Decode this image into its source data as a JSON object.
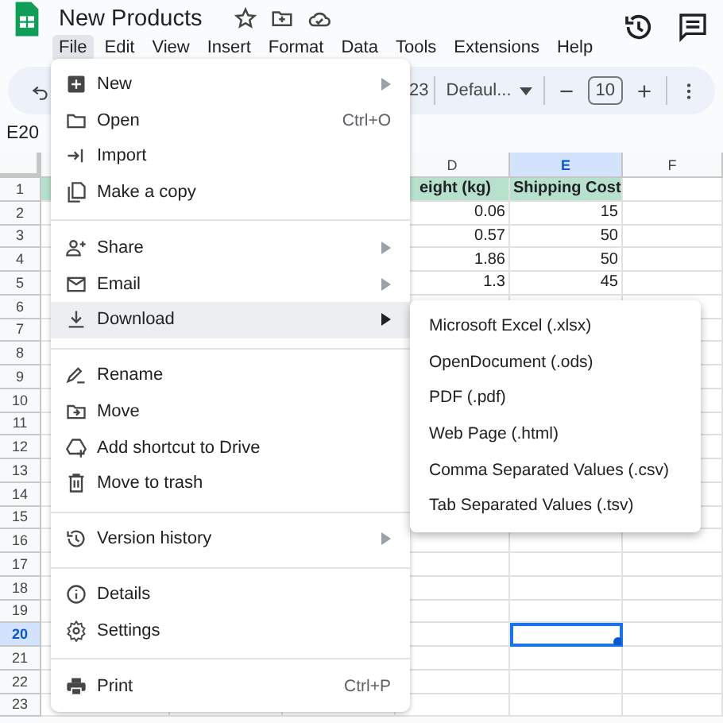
{
  "document": {
    "title": "New Products"
  },
  "menu_bar": [
    {
      "label": "File",
      "selected": true
    },
    {
      "label": "Edit",
      "selected": false
    },
    {
      "label": "View",
      "selected": false
    },
    {
      "label": "Insert",
      "selected": false
    },
    {
      "label": "Format",
      "selected": false
    },
    {
      "label": "Data",
      "selected": false
    },
    {
      "label": "Tools",
      "selected": false
    },
    {
      "label": "Extensions",
      "selected": false
    },
    {
      "label": "Help",
      "selected": false
    }
  ],
  "toolbar": {
    "number_format": "23",
    "font": "Defaul...",
    "font_size": "10"
  },
  "name_box": "E20",
  "sheet": {
    "columns": [
      {
        "label": "D",
        "selected": false
      },
      {
        "label": "E",
        "selected": true
      },
      {
        "label": "F",
        "selected": false
      }
    ],
    "rows": [
      {
        "number": "1",
        "selected": false,
        "kind": "header",
        "cells": {
          "D": "eight (kg)",
          "E": "Shipping Cost"
        }
      },
      {
        "number": "2",
        "selected": false,
        "cells": {
          "D": "0.06",
          "E": "15"
        }
      },
      {
        "number": "3",
        "selected": false,
        "cells": {
          "D": "0.57",
          "E": "50"
        }
      },
      {
        "number": "4",
        "selected": false,
        "cells": {
          "D": "1.86",
          "E": "50"
        }
      },
      {
        "number": "5",
        "selected": false,
        "cells": {
          "D": "1.3",
          "E": "45"
        }
      },
      {
        "number": "6",
        "selected": false
      },
      {
        "number": "7",
        "selected": false
      },
      {
        "number": "8",
        "selected": false
      },
      {
        "number": "9",
        "selected": false
      },
      {
        "number": "10",
        "selected": false
      },
      {
        "number": "11",
        "selected": false
      },
      {
        "number": "12",
        "selected": false
      },
      {
        "number": "13",
        "selected": false
      },
      {
        "number": "14",
        "selected": false
      },
      {
        "number": "15",
        "selected": false
      },
      {
        "number": "16",
        "selected": false
      },
      {
        "number": "17",
        "selected": false
      },
      {
        "number": "18",
        "selected": false
      },
      {
        "number": "19",
        "selected": false
      },
      {
        "number": "20",
        "selected": true
      },
      {
        "number": "21",
        "selected": false
      },
      {
        "number": "22",
        "selected": false
      },
      {
        "number": "23",
        "selected": false
      }
    ]
  },
  "file_menu": {
    "groups": [
      [
        {
          "label": "New",
          "submenu": true,
          "selected": false
        },
        {
          "label": "Open",
          "shortcut": "Ctrl+O",
          "selected": false
        },
        {
          "label": "Import",
          "selected": false
        },
        {
          "label": "Make a copy",
          "selected": false
        }
      ],
      [
        {
          "label": "Share",
          "submenu": true,
          "selected": false
        },
        {
          "label": "Email",
          "submenu": true,
          "selected": false
        },
        {
          "label": "Download",
          "submenu": true,
          "selected": true
        }
      ],
      [
        {
          "label": "Rename",
          "selected": false
        },
        {
          "label": "Move",
          "selected": false
        },
        {
          "label": "Add shortcut to Drive",
          "selected": false
        },
        {
          "label": "Move to trash",
          "selected": false
        }
      ],
      [
        {
          "label": "Version history",
          "submenu": true,
          "selected": false
        }
      ],
      [
        {
          "label": "Details",
          "selected": false
        },
        {
          "label": "Settings",
          "selected": false
        }
      ],
      [
        {
          "label": "Print",
          "shortcut": "Ctrl+P",
          "selected": false
        }
      ]
    ]
  },
  "download_submenu": [
    "Microsoft Excel (.xlsx)",
    "OpenDocument (.ods)",
    "PDF (.pdf)",
    "Web Page (.html)",
    "Comma Separated Values (.csv)",
    "Tab Separated Values (.tsv)"
  ]
}
